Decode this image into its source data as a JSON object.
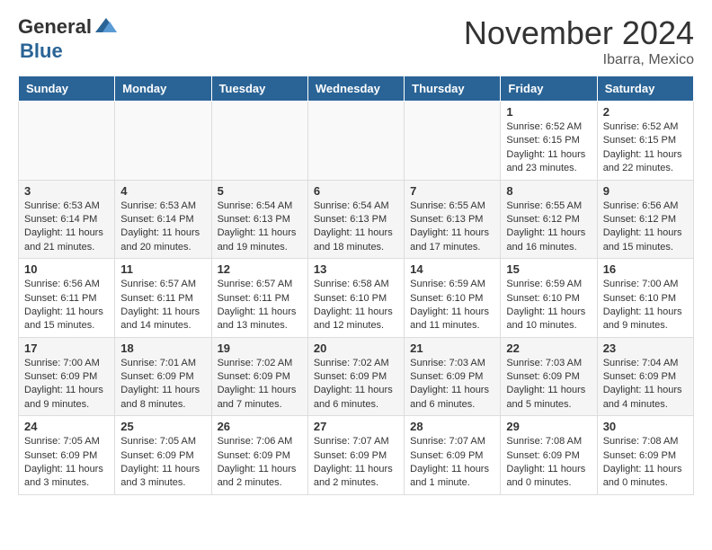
{
  "header": {
    "logo_general": "General",
    "logo_blue": "Blue",
    "month_title": "November 2024",
    "location": "Ibarra, Mexico"
  },
  "weekdays": [
    "Sunday",
    "Monday",
    "Tuesday",
    "Wednesday",
    "Thursday",
    "Friday",
    "Saturday"
  ],
  "weeks": [
    [
      {
        "day": "",
        "empty": true
      },
      {
        "day": "",
        "empty": true
      },
      {
        "day": "",
        "empty": true
      },
      {
        "day": "",
        "empty": true
      },
      {
        "day": "",
        "empty": true
      },
      {
        "day": "1",
        "sunrise": "Sunrise: 6:52 AM",
        "sunset": "Sunset: 6:15 PM",
        "daylight": "Daylight: 11 hours and 23 minutes."
      },
      {
        "day": "2",
        "sunrise": "Sunrise: 6:52 AM",
        "sunset": "Sunset: 6:15 PM",
        "daylight": "Daylight: 11 hours and 22 minutes."
      }
    ],
    [
      {
        "day": "3",
        "sunrise": "Sunrise: 6:53 AM",
        "sunset": "Sunset: 6:14 PM",
        "daylight": "Daylight: 11 hours and 21 minutes."
      },
      {
        "day": "4",
        "sunrise": "Sunrise: 6:53 AM",
        "sunset": "Sunset: 6:14 PM",
        "daylight": "Daylight: 11 hours and 20 minutes."
      },
      {
        "day": "5",
        "sunrise": "Sunrise: 6:54 AM",
        "sunset": "Sunset: 6:13 PM",
        "daylight": "Daylight: 11 hours and 19 minutes."
      },
      {
        "day": "6",
        "sunrise": "Sunrise: 6:54 AM",
        "sunset": "Sunset: 6:13 PM",
        "daylight": "Daylight: 11 hours and 18 minutes."
      },
      {
        "day": "7",
        "sunrise": "Sunrise: 6:55 AM",
        "sunset": "Sunset: 6:13 PM",
        "daylight": "Daylight: 11 hours and 17 minutes."
      },
      {
        "day": "8",
        "sunrise": "Sunrise: 6:55 AM",
        "sunset": "Sunset: 6:12 PM",
        "daylight": "Daylight: 11 hours and 16 minutes."
      },
      {
        "day": "9",
        "sunrise": "Sunrise: 6:56 AM",
        "sunset": "Sunset: 6:12 PM",
        "daylight": "Daylight: 11 hours and 15 minutes."
      }
    ],
    [
      {
        "day": "10",
        "sunrise": "Sunrise: 6:56 AM",
        "sunset": "Sunset: 6:11 PM",
        "daylight": "Daylight: 11 hours and 15 minutes."
      },
      {
        "day": "11",
        "sunrise": "Sunrise: 6:57 AM",
        "sunset": "Sunset: 6:11 PM",
        "daylight": "Daylight: 11 hours and 14 minutes."
      },
      {
        "day": "12",
        "sunrise": "Sunrise: 6:57 AM",
        "sunset": "Sunset: 6:11 PM",
        "daylight": "Daylight: 11 hours and 13 minutes."
      },
      {
        "day": "13",
        "sunrise": "Sunrise: 6:58 AM",
        "sunset": "Sunset: 6:10 PM",
        "daylight": "Daylight: 11 hours and 12 minutes."
      },
      {
        "day": "14",
        "sunrise": "Sunrise: 6:59 AM",
        "sunset": "Sunset: 6:10 PM",
        "daylight": "Daylight: 11 hours and 11 minutes."
      },
      {
        "day": "15",
        "sunrise": "Sunrise: 6:59 AM",
        "sunset": "Sunset: 6:10 PM",
        "daylight": "Daylight: 11 hours and 10 minutes."
      },
      {
        "day": "16",
        "sunrise": "Sunrise: 7:00 AM",
        "sunset": "Sunset: 6:10 PM",
        "daylight": "Daylight: 11 hours and 9 minutes."
      }
    ],
    [
      {
        "day": "17",
        "sunrise": "Sunrise: 7:00 AM",
        "sunset": "Sunset: 6:09 PM",
        "daylight": "Daylight: 11 hours and 9 minutes."
      },
      {
        "day": "18",
        "sunrise": "Sunrise: 7:01 AM",
        "sunset": "Sunset: 6:09 PM",
        "daylight": "Daylight: 11 hours and 8 minutes."
      },
      {
        "day": "19",
        "sunrise": "Sunrise: 7:02 AM",
        "sunset": "Sunset: 6:09 PM",
        "daylight": "Daylight: 11 hours and 7 minutes."
      },
      {
        "day": "20",
        "sunrise": "Sunrise: 7:02 AM",
        "sunset": "Sunset: 6:09 PM",
        "daylight": "Daylight: 11 hours and 6 minutes."
      },
      {
        "day": "21",
        "sunrise": "Sunrise: 7:03 AM",
        "sunset": "Sunset: 6:09 PM",
        "daylight": "Daylight: 11 hours and 6 minutes."
      },
      {
        "day": "22",
        "sunrise": "Sunrise: 7:03 AM",
        "sunset": "Sunset: 6:09 PM",
        "daylight": "Daylight: 11 hours and 5 minutes."
      },
      {
        "day": "23",
        "sunrise": "Sunrise: 7:04 AM",
        "sunset": "Sunset: 6:09 PM",
        "daylight": "Daylight: 11 hours and 4 minutes."
      }
    ],
    [
      {
        "day": "24",
        "sunrise": "Sunrise: 7:05 AM",
        "sunset": "Sunset: 6:09 PM",
        "daylight": "Daylight: 11 hours and 3 minutes."
      },
      {
        "day": "25",
        "sunrise": "Sunrise: 7:05 AM",
        "sunset": "Sunset: 6:09 PM",
        "daylight": "Daylight: 11 hours and 3 minutes."
      },
      {
        "day": "26",
        "sunrise": "Sunrise: 7:06 AM",
        "sunset": "Sunset: 6:09 PM",
        "daylight": "Daylight: 11 hours and 2 minutes."
      },
      {
        "day": "27",
        "sunrise": "Sunrise: 7:07 AM",
        "sunset": "Sunset: 6:09 PM",
        "daylight": "Daylight: 11 hours and 2 minutes."
      },
      {
        "day": "28",
        "sunrise": "Sunrise: 7:07 AM",
        "sunset": "Sunset: 6:09 PM",
        "daylight": "Daylight: 11 hours and 1 minute."
      },
      {
        "day": "29",
        "sunrise": "Sunrise: 7:08 AM",
        "sunset": "Sunset: 6:09 PM",
        "daylight": "Daylight: 11 hours and 0 minutes."
      },
      {
        "day": "30",
        "sunrise": "Sunrise: 7:08 AM",
        "sunset": "Sunset: 6:09 PM",
        "daylight": "Daylight: 11 hours and 0 minutes."
      }
    ]
  ]
}
